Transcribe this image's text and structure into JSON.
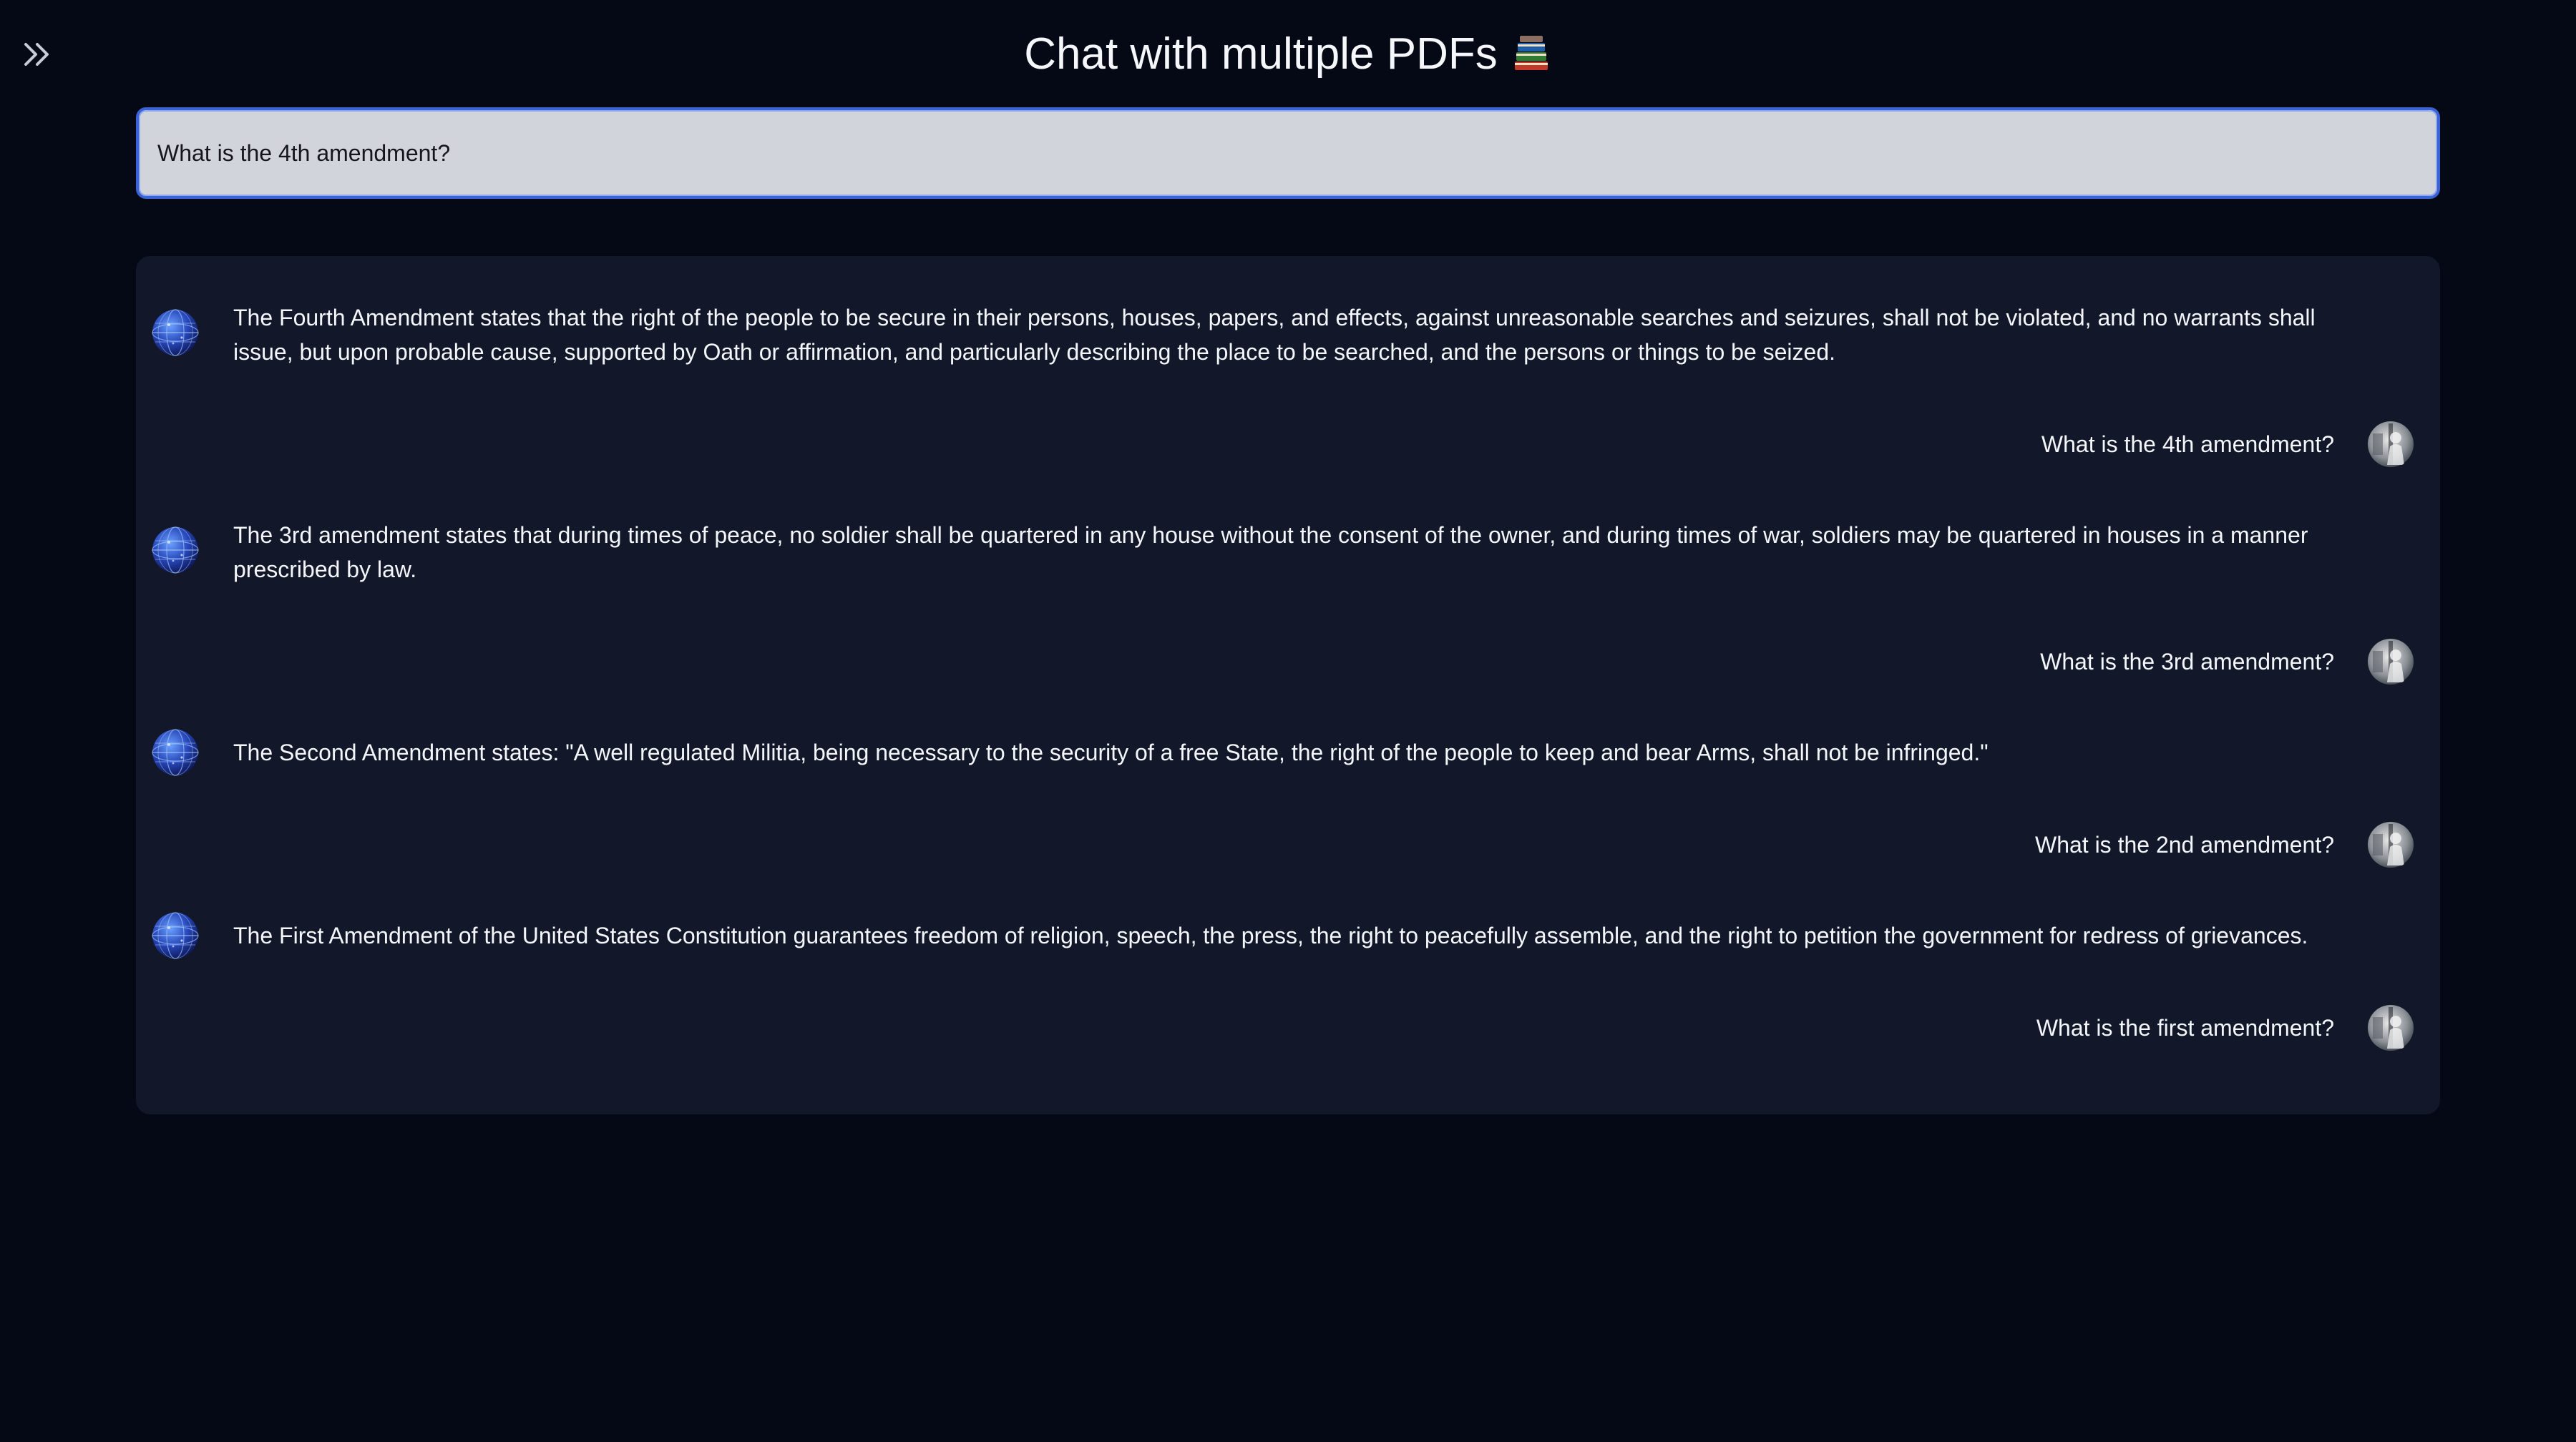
{
  "header": {
    "title": "Chat with multiple PDFs",
    "title_icon": "books-icon",
    "sidebar_toggle_icon": "double-chevron-right-icon"
  },
  "query": {
    "value": "What is the 4th amendment?"
  },
  "chat": {
    "messages": [
      {
        "role": "bot",
        "avatar": "globe-avatar",
        "text": "The Fourth Amendment states that the right of the people to be secure in their persons, houses, papers, and effects, against unreasonable searches and seizures, shall not be violated, and no warrants shall issue, but upon probable cause, supported by Oath or affirmation, and particularly describing the place to be searched, and the persons or things to be seized."
      },
      {
        "role": "user",
        "avatar": "user-avatar",
        "text": "What is the 4th amendment?"
      },
      {
        "role": "bot",
        "avatar": "globe-avatar",
        "text": "The 3rd amendment states that during times of peace, no soldier shall be quartered in any house without the consent of the owner, and during times of war, soldiers may be quartered in houses in a manner prescribed by law."
      },
      {
        "role": "user",
        "avatar": "user-avatar",
        "text": "What is the 3rd amendment?"
      },
      {
        "role": "bot",
        "avatar": "globe-avatar",
        "text": "The Second Amendment states: \"A well regulated Militia, being necessary to the security of a free State, the right of the people to keep and bear Arms, shall not be infringed.\""
      },
      {
        "role": "user",
        "avatar": "user-avatar",
        "text": "What is the 2nd amendment?"
      },
      {
        "role": "bot",
        "avatar": "globe-avatar",
        "text": "The First Amendment of the United States Constitution guarantees freedom of religion, speech, the press, the right to peacefully assemble, and the right to petition the government for redress of grievances."
      },
      {
        "role": "user",
        "avatar": "user-avatar",
        "text": "What is the first amendment?"
      }
    ]
  },
  "colors": {
    "page_background": "#050916",
    "panel_background": "#121829",
    "input_background": "#d1d5db",
    "input_focus_border": "#3b63d6",
    "text": "#f4f6fb"
  }
}
